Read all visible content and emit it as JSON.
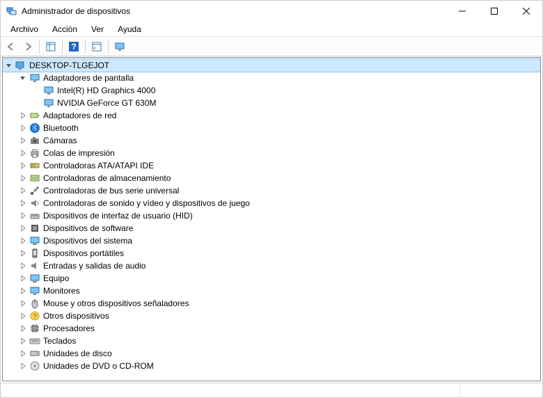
{
  "window": {
    "title": "Administrador de dispositivos"
  },
  "menu": {
    "file": "Archivo",
    "action": "Acción",
    "view": "Ver",
    "help": "Ayuda"
  },
  "tree": {
    "root": {
      "label": "DESKTOP-TLGEJOT",
      "expanded": true,
      "selected": true
    },
    "displayAdapters": {
      "label": "Adaptadores de pantalla",
      "expanded": true,
      "children": {
        "intel": "Intel(R) HD Graphics 4000",
        "nvidia": "NVIDIA GeForce GT 630M"
      }
    },
    "networkAdapters": "Adaptadores de red",
    "bluetooth": "Bluetooth",
    "cameras": "Cámaras",
    "printQueues": "Colas de impresión",
    "ataControllers": "Controladoras ATA/ATAPI IDE",
    "storageControllers": "Controladoras de almacenamiento",
    "usbControllers": "Controladoras de bus serie universal",
    "soundVideoGame": "Controladoras de sonido y vídeo y dispositivos de juego",
    "hid": "Dispositivos de interfaz de usuario (HID)",
    "softwareDevices": "Dispositivos de software",
    "systemDevices": "Dispositivos del sistema",
    "portableDevices": "Dispositivos portátiles",
    "audioIO": "Entradas y salidas de audio",
    "computer": "Equipo",
    "monitors": "Monitores",
    "mice": "Mouse y otros dispositivos señaladores",
    "otherDevices": "Otros dispositivos",
    "processors": "Procesadores",
    "keyboards": "Teclados",
    "diskDrives": "Unidades de disco",
    "dvdCdrom": "Unidades de DVD o CD-ROM"
  }
}
